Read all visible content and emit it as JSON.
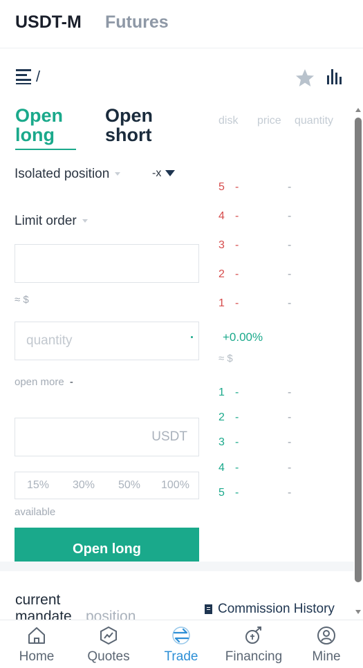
{
  "top_tabs": {
    "active": "USDT-M",
    "inactive": "Futures"
  },
  "pair": {
    "label": "/"
  },
  "side_tabs": {
    "long": "Open long",
    "short": "Open short"
  },
  "order_form": {
    "margin_mode": "Isolated position",
    "leverage": "-x",
    "order_type": "Limit order",
    "price_approx": "≈ $",
    "quantity_placeholder": "quantity",
    "open_more_label": "open more",
    "open_more_value": "-",
    "cost_unit": "USDT",
    "percentages": [
      "15%",
      "30%",
      "50%",
      "100%"
    ],
    "available_label": "available",
    "submit_label": "Open long"
  },
  "orderbook": {
    "headers": {
      "disk": "disk",
      "price": "price",
      "quantity": "quantity"
    },
    "asks": [
      {
        "n": "5",
        "price": "-",
        "qty": "-"
      },
      {
        "n": "4",
        "price": "-",
        "qty": "-"
      },
      {
        "n": "3",
        "price": "-",
        "qty": "-"
      },
      {
        "n": "2",
        "price": "-",
        "qty": "-"
      },
      {
        "n": "1",
        "price": "-",
        "qty": "-"
      }
    ],
    "last_change": "+0.00%",
    "last_approx": "≈ $",
    "bids": [
      {
        "n": "1",
        "price": "-",
        "qty": "-"
      },
      {
        "n": "2",
        "price": "-",
        "qty": "-"
      },
      {
        "n": "3",
        "price": "-",
        "qty": "-"
      },
      {
        "n": "4",
        "price": "-",
        "qty": "-"
      },
      {
        "n": "5",
        "price": "-",
        "qty": "-"
      }
    ]
  },
  "records": {
    "current": "current mandate",
    "position": "position",
    "commission": "Commission History"
  },
  "nav": [
    {
      "label": "Home",
      "icon": "home-icon"
    },
    {
      "label": "Quotes",
      "icon": "quotes-icon"
    },
    {
      "label": "Trade",
      "icon": "trade-icon",
      "active": true
    },
    {
      "label": "Financing",
      "icon": "financing-icon"
    },
    {
      "label": "Mine",
      "icon": "user-icon"
    }
  ],
  "colors": {
    "accent": "#1aa98b",
    "ask": "#d64b4b",
    "nav_active": "#2d8fd6"
  }
}
